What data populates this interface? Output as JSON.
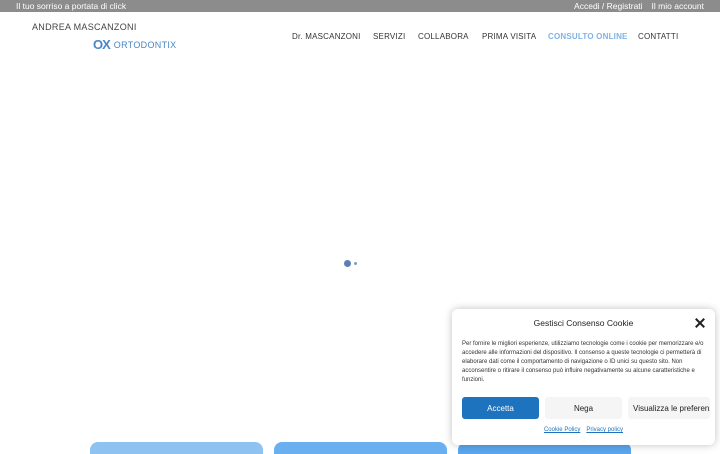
{
  "topbar": {
    "tagline": "Il tuo sorriso a portata di click",
    "login_link": "Accedi / Registrati",
    "account_link": "Il mio account"
  },
  "logo": {
    "name": "ANDREA MASCANZONI",
    "mark": "OX",
    "sub": "ORTODONTIX"
  },
  "nav": {
    "items": [
      {
        "label": "Dr. MASCANZONI"
      },
      {
        "label": "SERVIZI"
      },
      {
        "label": "COLLABORA"
      },
      {
        "label": "PRIMA VISITA"
      },
      {
        "label": "CONSULTO ONLINE"
      },
      {
        "label": "CONTATTI"
      }
    ],
    "active_color": "#7fb3e6"
  },
  "cookie": {
    "title": "Gestisci Consenso Cookie",
    "body": "Per fornire le migliori esperienze, utilizziamo tecnologie come i cookie per memorizzare e/o accedere alle informazioni del dispositivo. Il consenso a queste tecnologie ci permetterà di elaborare dati come il comportamento di navigazione o ID unici su questo sito. Non acconsentire o ritirare il consenso può influire negativamente su alcune caratteristiche e funzioni.",
    "accept_label": "Accetta",
    "deny_label": "Nega",
    "prefs_label": "Visualizza le preferenze",
    "cookie_policy_label": "Cookie Policy",
    "privacy_policy_label": "Privacy policy",
    "accent_color": "#1e73be"
  }
}
